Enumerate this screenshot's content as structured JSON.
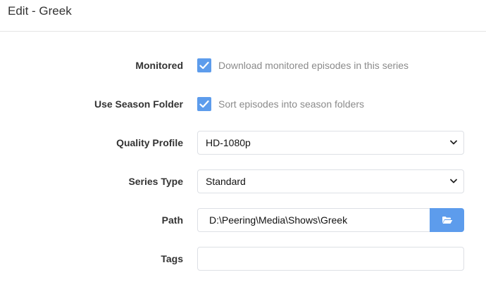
{
  "modal": {
    "title": "Edit - Greek"
  },
  "form": {
    "monitored": {
      "label": "Monitored",
      "checked": true,
      "help": "Download monitored episodes in this series"
    },
    "season_folder": {
      "label": "Use Season Folder",
      "checked": true,
      "help": "Sort episodes into season folders"
    },
    "quality_profile": {
      "label": "Quality Profile",
      "value": "HD-1080p"
    },
    "series_type": {
      "label": "Series Type",
      "value": "Standard"
    },
    "path": {
      "label": "Path",
      "value": "D:\\Peering\\Media\\Shows\\Greek",
      "browse_icon": "folder-open-icon"
    },
    "tags": {
      "label": "Tags",
      "value": ""
    }
  },
  "colors": {
    "accent": "#5d9cec",
    "border": "#dde0e5",
    "help_text": "#8b8b8b"
  }
}
